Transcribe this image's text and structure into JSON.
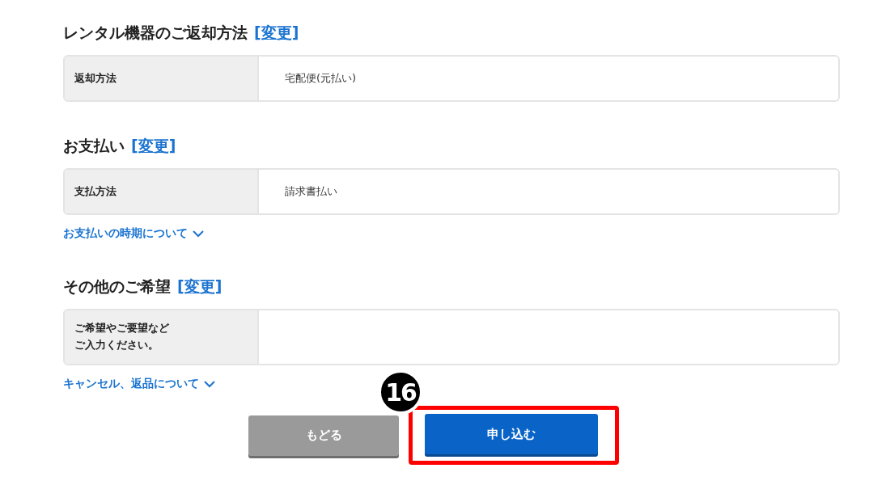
{
  "sections": [
    {
      "title": "レンタル機器のご返却方法",
      "change_link": "[変更]",
      "rows": [
        {
          "label": "返却方法",
          "value": "宅配便(元払い)"
        }
      ]
    },
    {
      "title": "お支払い",
      "change_link": "[変更]",
      "rows": [
        {
          "label": "支払方法",
          "value": "請求書払い"
        }
      ],
      "toggle_link": "お支払いの時期について"
    },
    {
      "title": "その他のご希望",
      "change_link": "[変更]",
      "rows": [
        {
          "label_lines": [
            "ご希望やご要望など",
            "ご入力ください。"
          ]
        }
      ],
      "toggle_link": "キャンセル、返品について"
    }
  ],
  "buttons": [
    {
      "kind": "secondary",
      "label": "もどる",
      "highlighted": false
    },
    {
      "kind": "primary",
      "label": "申し込む",
      "highlighted": true,
      "step_badge": "16"
    }
  ]
}
